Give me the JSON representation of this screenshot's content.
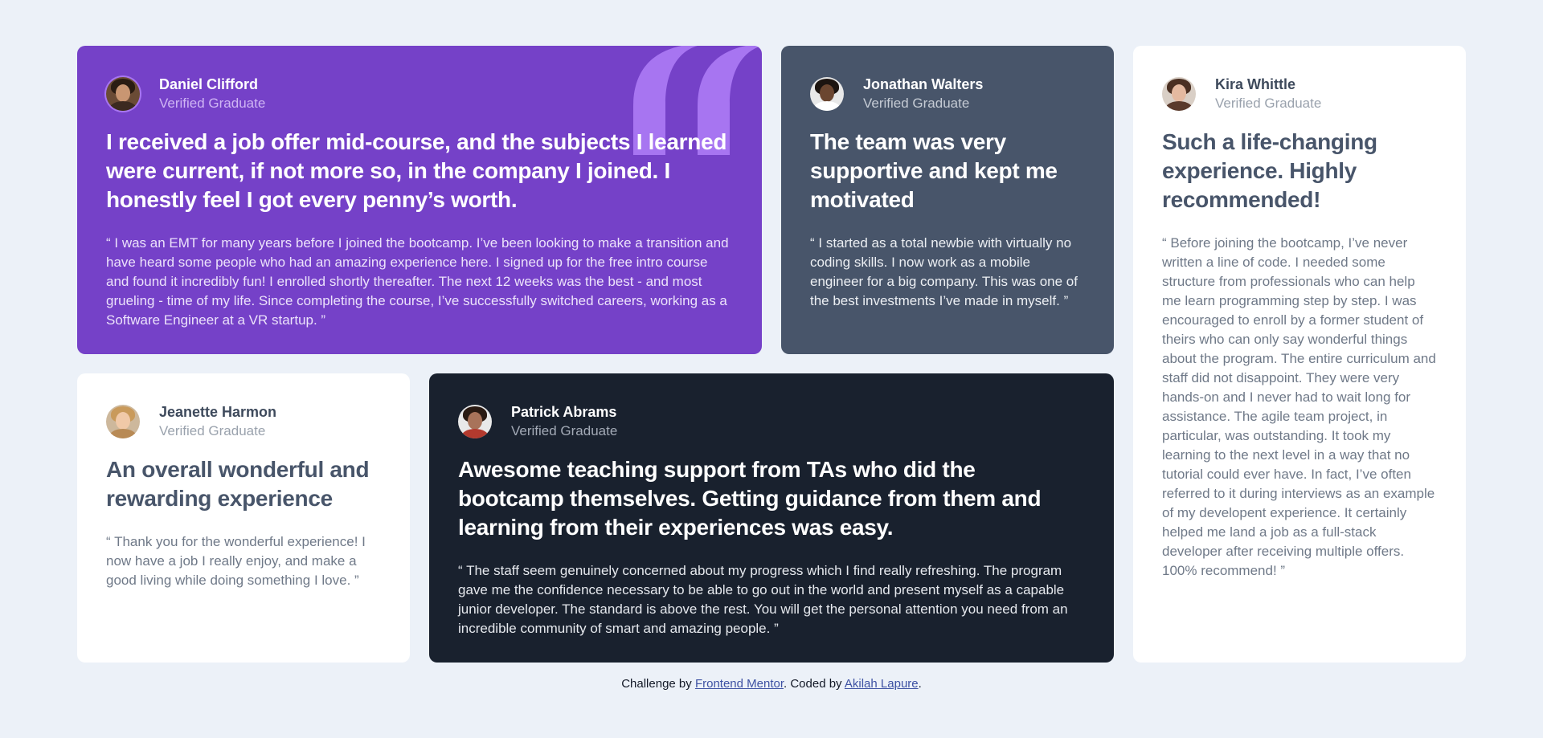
{
  "colors": {
    "page_bg": "#ecf1f8",
    "purple": "#7541c8",
    "grayblue": "#48556a",
    "dark": "#19212e",
    "white": "#ffffff",
    "link": "#3e52a3"
  },
  "testimonials": [
    {
      "name": "Daniel Clifford",
      "role": "Verified Graduate",
      "headline": "I received a job offer mid-course, and the subjects I learned were current, if not more so, in the company I joined. I honestly feel I got every penny’s worth.",
      "quote": "“ I was an EMT for many years before I joined the bootcamp. I’ve been looking to make a transition and have heard some people who had an amazing experience here. I signed up for the free intro course and found it incredibly fun! I enrolled shortly thereafter. The next 12 weeks was the best - and most grueling - time of my life. Since completing the course, I’ve successfully switched careers, working as a Software Engineer at a VR startup. ”",
      "avatar_icon": "avatar-daniel-icon"
    },
    {
      "name": "Jonathan Walters",
      "role": "Verified Graduate",
      "headline": "The team was very supportive and kept me motivated",
      "quote": "“ I started as a total newbie with virtually no coding skills. I now work as a mobile engineer for a big company. This was one of the best investments I’ve made in myself. ”",
      "avatar_icon": "avatar-jonathan-icon"
    },
    {
      "name": "Kira Whittle",
      "role": "Verified Graduate",
      "headline": "Such a life-changing experience. Highly recommended!",
      "quote": "“ Before joining the bootcamp, I’ve never written a line of code. I needed some structure from professionals who can help me learn programming step by step. I was encouraged to enroll by a former student of theirs who can only say wonderful things about the program. The entire curriculum and staff did not disappoint. They were very hands-on and I never had to wait long for assistance. The agile team project, in particular, was outstanding. It took my learning to the next level in a way that no tutorial could ever have. In fact, I’ve often referred to it during interviews as an example of my develop​ent experience. It certainly helped me land a job as a full-stack developer after receiving multiple offers. 100% recommend! ”",
      "avatar_icon": "avatar-kira-icon"
    },
    {
      "name": "Jeanette Harmon",
      "role": "Verified Graduate",
      "headline": "An overall wonderful and rewarding experience",
      "quote": "“ Thank you for the wonderful experience! I now have a job I really enjoy, and make a good living while doing something I love. ”",
      "avatar_icon": "avatar-jeanette-icon"
    },
    {
      "name": "Patrick Abrams",
      "role": "Verified Graduate",
      "headline": "Awesome teaching support from TAs who did the bootcamp themselves. Getting guidance from them and learning from their experiences was easy.",
      "quote": "“ The staff seem genuinely concerned about my progress which I find really refreshing. The program gave me the confidence necessary to be able to go out in the world and present myself as a capable junior developer. The standard is above the rest. You will get the personal attention you need from an incredible community of smart and amazing people. ”",
      "avatar_icon": "avatar-patrick-icon"
    }
  ],
  "footer": {
    "prefix": "Challenge by ",
    "link1": "Frontend Mentor",
    "middle": ". Coded by ",
    "link2": "Akilah Lapure",
    "suffix": "."
  }
}
